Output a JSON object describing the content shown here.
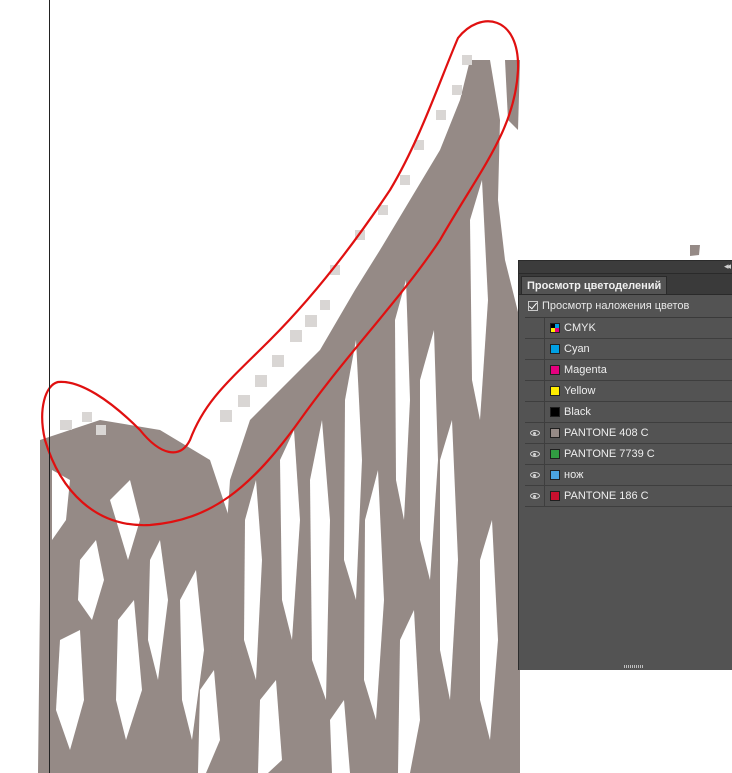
{
  "panel": {
    "tab_title": "Просмотр цветоделений",
    "overprint_label": "Просмотр наложения цветов",
    "overprint_checked": true,
    "rows": [
      {
        "label": "CMYK",
        "color": "cmyk",
        "visible": false
      },
      {
        "label": "Cyan",
        "color": "#00a0e3",
        "visible": false
      },
      {
        "label": "Magenta",
        "color": "#e5007e",
        "visible": false
      },
      {
        "label": "Yellow",
        "color": "#ffed00",
        "visible": false
      },
      {
        "label": "Black",
        "color": "#000000",
        "visible": false
      },
      {
        "label": "PANTONE 408 C",
        "color": "#958a86",
        "visible": true
      },
      {
        "label": "PANTONE 7739 C",
        "color": "#319b42",
        "visible": true
      },
      {
        "label": "нож",
        "color": "#4aa3df",
        "visible": true
      },
      {
        "label": "PANTONE 186 C",
        "color": "#c8102e",
        "visible": true
      }
    ]
  },
  "colors": {
    "ink": "#958a86",
    "annotation": "#e01010",
    "panel_bg": "#535353"
  }
}
